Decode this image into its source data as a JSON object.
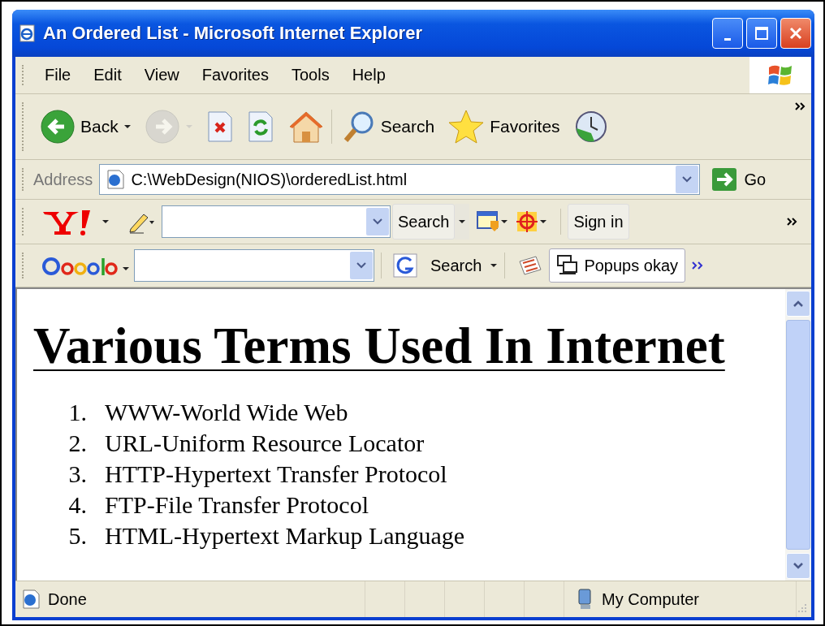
{
  "window": {
    "title": "An Ordered List - Microsoft Internet Explorer"
  },
  "menu": [
    "File",
    "Edit",
    "View",
    "Favorites",
    "Tools",
    "Help"
  ],
  "toolbar": [
    {
      "kind": "back",
      "label": "Back",
      "disabled": false
    },
    {
      "kind": "forward",
      "disabled": true
    },
    {
      "kind": "stop",
      "disabled": false
    },
    {
      "kind": "refresh",
      "disabled": false
    },
    {
      "kind": "home",
      "disabled": false
    },
    {
      "kind": "search",
      "label": "Search",
      "disabled": false
    },
    {
      "kind": "favorites",
      "label": "Favorites",
      "disabled": false
    },
    {
      "kind": "history",
      "disabled": false
    }
  ],
  "address": {
    "label": "Address",
    "value": "C:\\WebDesign(NIOS)\\orderedList.html",
    "go": "Go"
  },
  "yahoo_toolbar": {
    "search": "Search",
    "sign_in": "Sign in"
  },
  "google_toolbar": {
    "search": "Search",
    "popups": "Popups okay"
  },
  "page": {
    "heading": "Various Terms Used In Internet",
    "items": [
      {
        "number": "1.",
        "text": "WWW-World Wide Web"
      },
      {
        "number": "2.",
        "text": "URL-Uniform Resource Locator"
      },
      {
        "number": "3.",
        "text": "HTTP-Hypertext Transfer Protocol"
      },
      {
        "number": "4.",
        "text": "FTP-File Transfer Protocol"
      },
      {
        "number": "5.",
        "text": "HTML-Hypertext Markup Language"
      }
    ]
  },
  "status_bar": {
    "status": "Done",
    "zone": "My Computer"
  }
}
